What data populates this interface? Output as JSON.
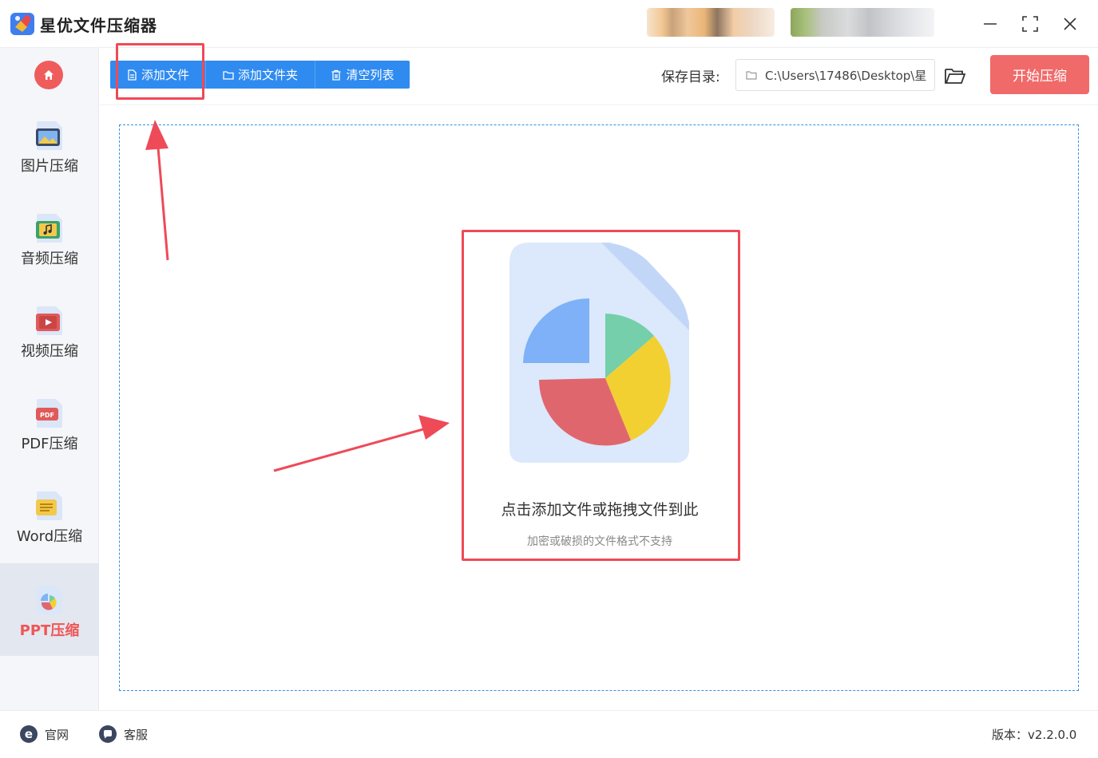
{
  "app": {
    "title": "星优文件压缩器"
  },
  "sidebar": {
    "items": [
      {
        "label": "图片压缩",
        "icon": "image-icon"
      },
      {
        "label": "音频压缩",
        "icon": "music-icon"
      },
      {
        "label": "视频压缩",
        "icon": "video-icon"
      },
      {
        "label": "PDF压缩",
        "icon": "pdf-icon"
      },
      {
        "label": "Word压缩",
        "icon": "word-icon"
      },
      {
        "label": "PPT压缩",
        "icon": "ppt-icon",
        "active": true
      }
    ]
  },
  "toolbar": {
    "add_file": "添加文件",
    "add_folder": "添加文件夹",
    "clear_list": "清空列表",
    "save_dir_label": "保存目录:",
    "save_dir_value": "C:\\Users\\17486\\Desktop\\星",
    "start_label": "开始压缩"
  },
  "dropzone": {
    "main_text": "点击添加文件或拖拽文件到此",
    "sub_text": "加密或破损的文件格式不支持"
  },
  "footer": {
    "website": "官网",
    "support": "客服",
    "version": "版本：v2.2.0.0"
  },
  "colors": {
    "accent_blue": "#2f8bf0",
    "accent_red": "#f06a6a",
    "highlight_red": "#ef4a57"
  }
}
